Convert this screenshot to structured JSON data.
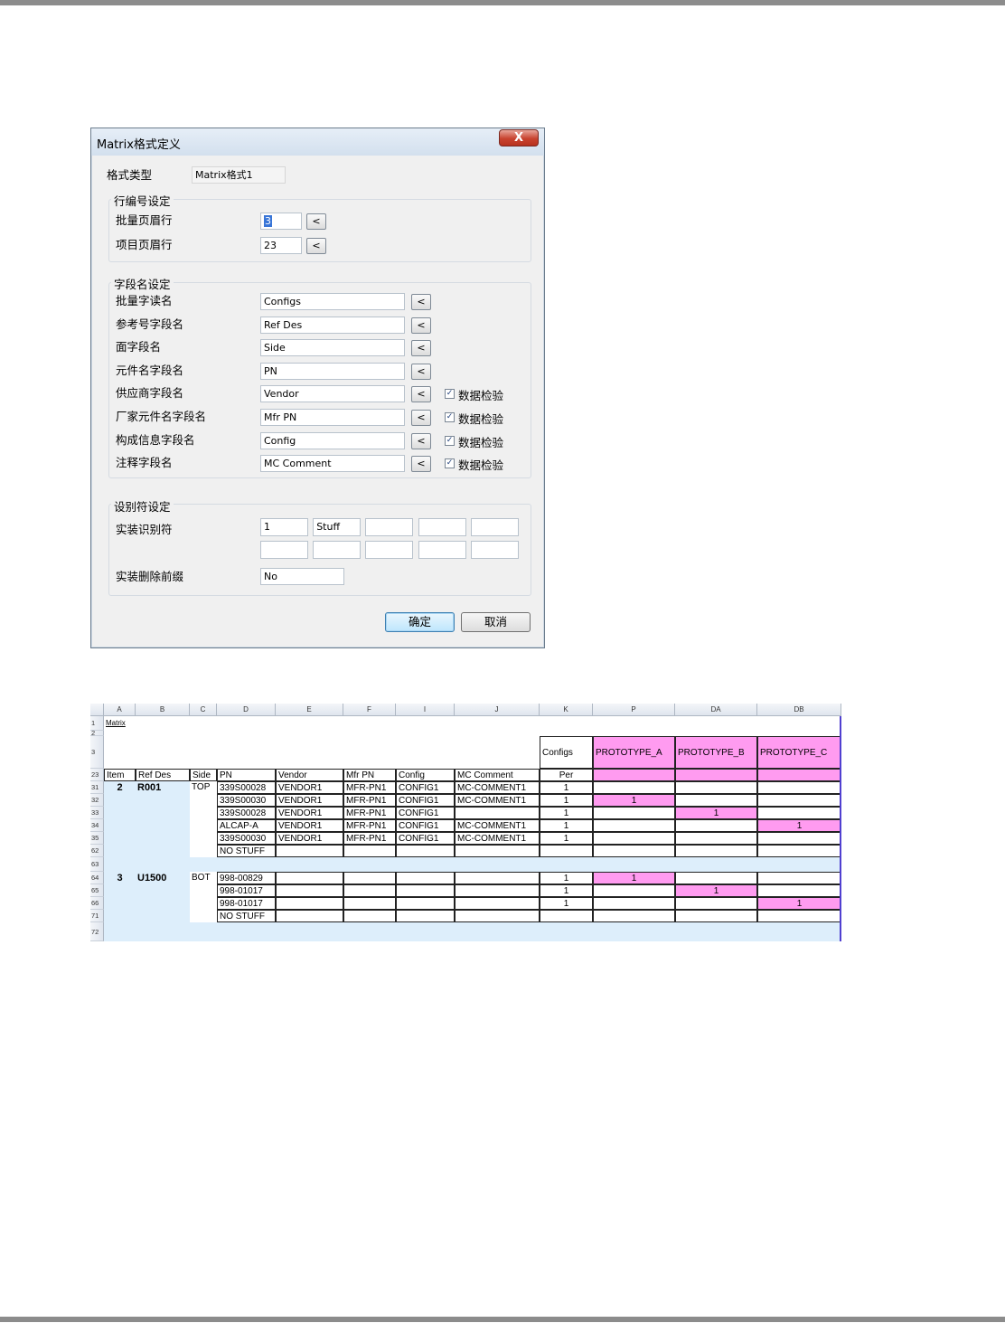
{
  "dialog": {
    "title": "Matrix格式定义",
    "close_label": "X",
    "format_type": {
      "label": "格式类型",
      "value": "Matrix格式1"
    },
    "row_group": {
      "title": "行编号设定",
      "rows": [
        {
          "label": "批量页眉行",
          "value": "3"
        },
        {
          "label": "项目页眉行",
          "value": "23"
        }
      ]
    },
    "field_group": {
      "title": "字段名设定",
      "rows": [
        {
          "label": "批量字读名",
          "value": "Configs",
          "check": false
        },
        {
          "label": "参考号字段名",
          "value": "Ref Des",
          "check": false
        },
        {
          "label": "面字段名",
          "value": "Side",
          "check": false
        },
        {
          "label": "元件名字段名",
          "value": " PN",
          "check": false
        },
        {
          "label": "供应商字段名",
          "value": "Vendor",
          "check": true
        },
        {
          "label": "厂家元件名字段名",
          "value": "Mfr PN",
          "check": true
        },
        {
          "label": "构成信息字段名",
          "value": "Config",
          "check": true
        },
        {
          "label": "注释字段名",
          "value": "MC Comment",
          "check": true
        }
      ],
      "check_label": "数据检验",
      "pick_label": "<"
    },
    "identifier_group": {
      "title": "设别符设定",
      "mount_label": "实装识别符",
      "mount_values_row1": [
        "1",
        "Stuff",
        "",
        "",
        ""
      ],
      "mount_values_row2": [
        "",
        "",
        "",
        "",
        ""
      ],
      "prefix_label": "实装删除前缀",
      "prefix_value": "No"
    },
    "ok_label": "确定",
    "cancel_label": "取消"
  },
  "sheet": {
    "col_headers": [
      "A",
      "B",
      "C",
      "D",
      "E",
      "F",
      "I",
      "J",
      "K",
      "P",
      "DA",
      "DB"
    ],
    "row_headers": [
      "1",
      "2",
      "3",
      "23",
      "31",
      "32",
      "33",
      "34",
      "35",
      "62",
      "63",
      "64",
      "65",
      "66",
      "71",
      "72"
    ],
    "a1": "Matrix",
    "configs_label": "Configs",
    "prototypes": [
      "PROTOTYPE_A",
      "PROTOTYPE_B",
      "PROTOTYPE_C"
    ],
    "headers": [
      "Item",
      "Ref Des",
      "Side",
      " PN",
      "Vendor",
      "Mfr PN",
      "Config",
      "MC Comment",
      "Per"
    ],
    "groups": [
      {
        "item": "2",
        "ref": "R001",
        "side": "TOP",
        "rows": [
          {
            "pn": "339S00028",
            "vendor": "VENDOR1",
            "mfr": "MFR-PN1",
            "config": "CONFIG1",
            "comment": "MC-COMMENT1",
            "per": "1",
            "a": "",
            "b": "",
            "c": ""
          },
          {
            "pn": "339S00030",
            "vendor": "VENDOR1",
            "mfr": "MFR-PN1",
            "config": "CONFIG1",
            "comment": "MC-COMMENT1",
            "per": "1",
            "a": "1",
            "b": "",
            "c": ""
          },
          {
            "pn": "339S00028",
            "vendor": "VENDOR1",
            "mfr": "MFR-PN1",
            "config": "CONFIG1",
            "comment": "",
            "per": "1",
            "a": "",
            "b": "1",
            "c": ""
          },
          {
            "pn": "ALCAP-A",
            "vendor": "VENDOR1",
            "mfr": "MFR-PN1",
            "config": "CONFIG1",
            "comment": "MC-COMMENT1",
            "per": "1",
            "a": "",
            "b": "",
            "c": "1"
          },
          {
            "pn": "339S00030",
            "vendor": "VENDOR1",
            "mfr": "MFR-PN1",
            "config": "CONFIG1",
            "comment": "MC-COMMENT1",
            "per": "1",
            "a": "",
            "b": "",
            "c": ""
          },
          {
            "pn": "NO STUFF",
            "vendor": "",
            "mfr": "",
            "config": "",
            "comment": "",
            "per": "",
            "a": "",
            "b": "",
            "c": ""
          }
        ]
      },
      {
        "item": "3",
        "ref": "U1500",
        "side": "BOT",
        "rows": [
          {
            "pn": "998-00829",
            "vendor": "",
            "mfr": "",
            "config": "",
            "comment": "",
            "per": "1",
            "a": "1",
            "b": "",
            "c": ""
          },
          {
            "pn": "998-01017",
            "vendor": "",
            "mfr": "",
            "config": "",
            "comment": "",
            "per": "1",
            "a": "",
            "b": "1",
            "c": ""
          },
          {
            "pn": "998-01017",
            "vendor": "",
            "mfr": "",
            "config": "",
            "comment": "",
            "per": "1",
            "a": "",
            "b": "",
            "c": "1"
          },
          {
            "pn": "NO STUFF",
            "vendor": "",
            "mfr": "",
            "config": "",
            "comment": "",
            "per": "",
            "a": "",
            "b": "",
            "c": ""
          }
        ]
      }
    ]
  }
}
